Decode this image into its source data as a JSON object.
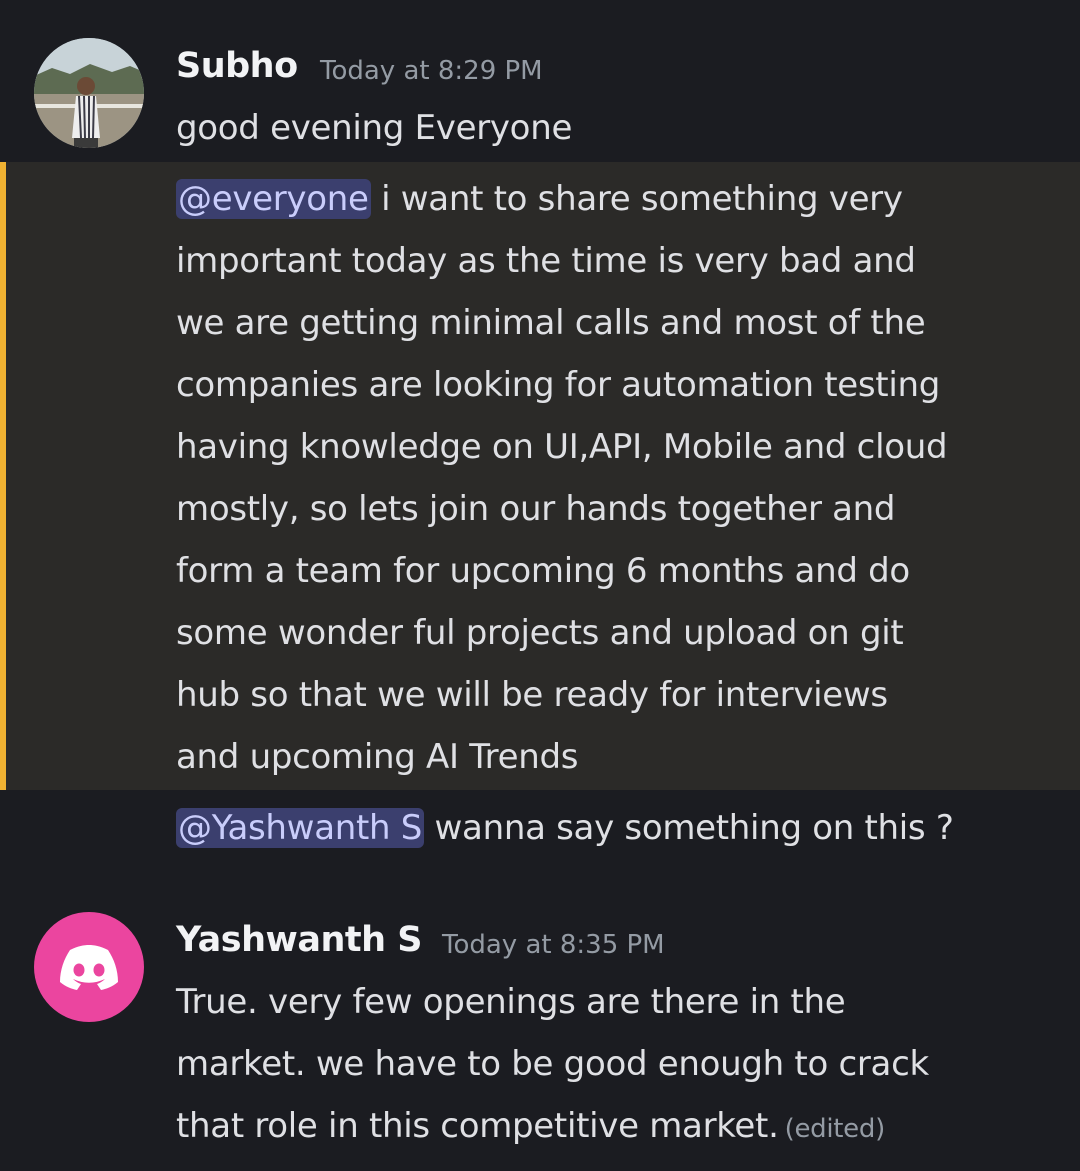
{
  "messages": [
    {
      "username": "Subho",
      "timestamp": "Today at 8:29 PM",
      "lines": {
        "l1": "good evening Everyone",
        "mention_everyone": "@everyone",
        "l2_rest": " i want to share something very",
        "l3": "important today as the time is very bad and",
        "l4": "we are getting minimal calls and most of the",
        "l5": "companies are looking for automation testing",
        "l6": "having knowledge on UI,API, Mobile and cloud",
        "l7": "mostly, so lets join our hands together and",
        "l8": "form a team for upcoming 6 months and do",
        "l9": "some wonder ful projects and upload on git",
        "l10": "hub so that we will be ready for interviews",
        "l11": "and upcoming AI Trends",
        "mention_user": "@Yashwanth S",
        "l12_rest": " wanna say something on this ?"
      }
    },
    {
      "username": "Yashwanth S",
      "timestamp": "Today at 8:35 PM",
      "lines": {
        "l1": "True. very few openings are there in the",
        "l2": "market. we have to be good enough to crack",
        "l3": "that role in this competitive market.",
        "edited": "(edited)"
      }
    }
  ],
  "colors": {
    "background": "#1b1c21",
    "highlight_background": "#2b2a28",
    "highlight_bar": "#f0b232",
    "mention_background": "#3b3f6e",
    "mention_text": "#c9cdfb",
    "discord_avatar": "#eb459f"
  },
  "icons": {
    "subho_avatar": "user-photo-avatar",
    "yashwanth_avatar": "discord-logo-icon"
  }
}
